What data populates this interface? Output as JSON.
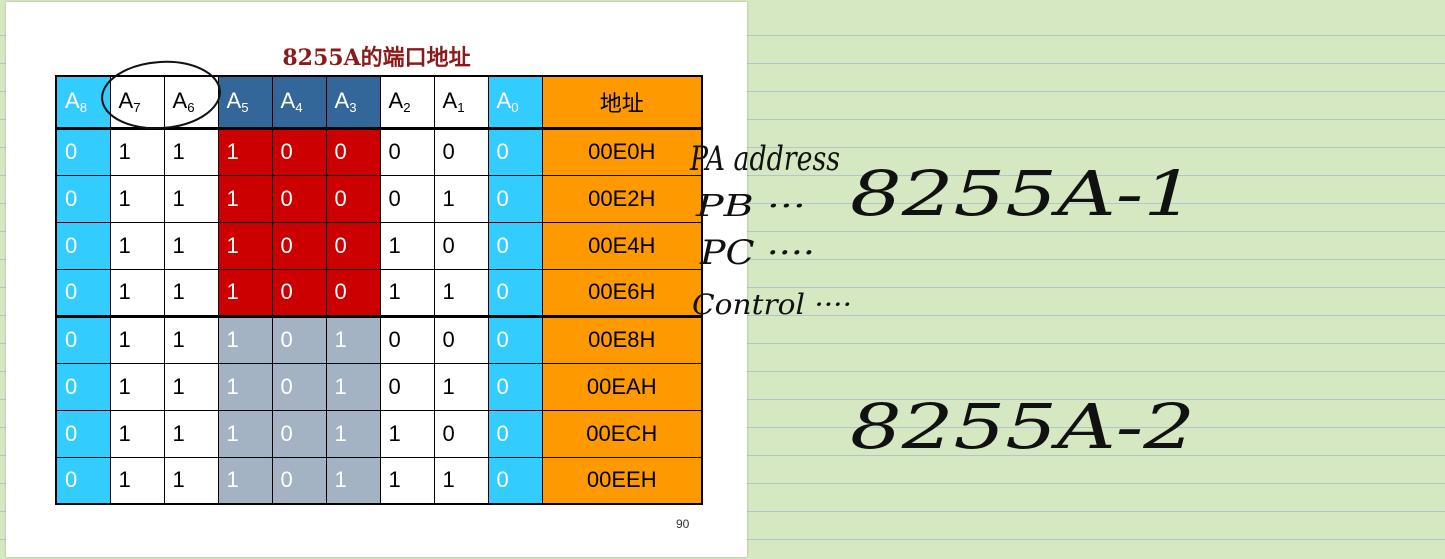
{
  "slide": {
    "title": "8255A的端口地址",
    "page_number": "90",
    "headers": [
      {
        "base": "A",
        "sub": "8",
        "color": "cyan"
      },
      {
        "base": "A",
        "sub": "7",
        "color": "white"
      },
      {
        "base": "A",
        "sub": "6",
        "color": "white"
      },
      {
        "base": "A",
        "sub": "5",
        "color": "hdrblue"
      },
      {
        "base": "A",
        "sub": "4",
        "color": "hdrblue"
      },
      {
        "base": "A",
        "sub": "3",
        "color": "hdrblue"
      },
      {
        "base": "A",
        "sub": "2",
        "color": "white"
      },
      {
        "base": "A",
        "sub": "1",
        "color": "white"
      },
      {
        "base": "A",
        "sub": "0",
        "color": "cyan"
      }
    ],
    "address_header": "地址",
    "rows": [
      {
        "bits": [
          "0",
          "1",
          "1",
          "1",
          "0",
          "0",
          "0",
          "0",
          "0"
        ],
        "address": "00E0H",
        "group": "red"
      },
      {
        "bits": [
          "0",
          "1",
          "1",
          "1",
          "0",
          "0",
          "0",
          "1",
          "0"
        ],
        "address": "00E2H",
        "group": "red"
      },
      {
        "bits": [
          "0",
          "1",
          "1",
          "1",
          "0",
          "0",
          "1",
          "0",
          "0"
        ],
        "address": "00E4H",
        "group": "red"
      },
      {
        "bits": [
          "0",
          "1",
          "1",
          "1",
          "0",
          "0",
          "1",
          "1",
          "0"
        ],
        "address": "00E6H",
        "group": "red"
      },
      {
        "bits": [
          "0",
          "1",
          "1",
          "1",
          "0",
          "1",
          "0",
          "0",
          "0"
        ],
        "address": "00E8H",
        "group": "grey"
      },
      {
        "bits": [
          "0",
          "1",
          "1",
          "1",
          "0",
          "1",
          "0",
          "1",
          "0"
        ],
        "address": "00EAH",
        "group": "grey"
      },
      {
        "bits": [
          "0",
          "1",
          "1",
          "1",
          "0",
          "1",
          "1",
          "0",
          "0"
        ],
        "address": "00ECH",
        "group": "grey"
      },
      {
        "bits": [
          "0",
          "1",
          "1",
          "1",
          "0",
          "1",
          "1",
          "1",
          "0"
        ],
        "address": "00EEH",
        "group": "grey"
      }
    ]
  },
  "handwriting": {
    "row_notes": [
      "PA address",
      "PB ···",
      "PC ····",
      "Control ····"
    ],
    "group_labels": [
      "8255A-1",
      "8255A-2"
    ]
  },
  "colors": {
    "cyan": "#33ccff",
    "header_blue": "#336699",
    "red_block": "#cc0000",
    "grey_block": "#a3b3c3",
    "address_orange": "#ff9900",
    "title_red": "#8b1a1a",
    "notebook_green": "#d5e8c1",
    "ink": "#111111"
  }
}
